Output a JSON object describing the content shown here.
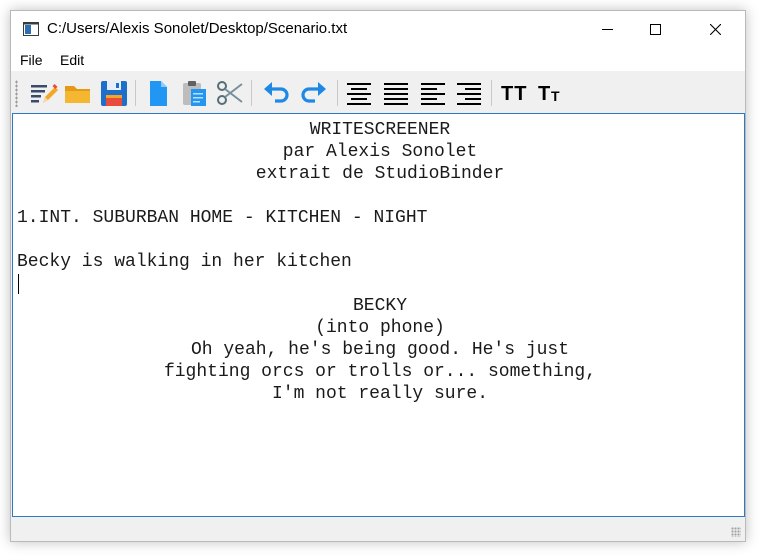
{
  "window": {
    "title": "C:/Users/Alexis Sonolet/Desktop/Scenario.txt",
    "controls": {
      "minimize_icon": "minimize-icon",
      "maximize_icon": "maximize-icon",
      "close_icon": "close-icon"
    }
  },
  "menubar": {
    "items": [
      "File",
      "Edit"
    ]
  },
  "toolbar": {
    "tools": [
      "new-document-icon",
      "open-folder-icon",
      "save-icon",
      "copy-icon",
      "paste-icon",
      "cut-icon",
      "undo-icon",
      "redo-icon",
      "align-center-icon",
      "align-justify-icon",
      "align-left-icon",
      "align-right-icon",
      "uppercase-icon",
      "small-caps-icon"
    ],
    "uppercase_label": "TT",
    "smallcaps_big": "T",
    "smallcaps_small": "T"
  },
  "colors": {
    "accent": "#2b79c7",
    "folder": "#f0a81e",
    "save": "#1e6fc9",
    "undo": "#1e88e5"
  },
  "document": {
    "lines": [
      {
        "text": "WRITESCREENER",
        "align": "center"
      },
      {
        "text": "par Alexis Sonolet",
        "align": "center"
      },
      {
        "text": "extrait de StudioBinder",
        "align": "center"
      },
      {
        "text": "",
        "align": "left"
      },
      {
        "text": "1.INT. SUBURBAN HOME - KITCHEN - NIGHT",
        "align": "left"
      },
      {
        "text": "",
        "align": "left"
      },
      {
        "text": "Becky is walking in her kitchen",
        "align": "left"
      },
      {
        "text": "",
        "align": "left"
      },
      {
        "text": "BECKY",
        "align": "center"
      },
      {
        "text": "(into phone)",
        "align": "center"
      },
      {
        "text": "Oh yeah, he's being good. He's just",
        "align": "center"
      },
      {
        "text": "fighting orcs or trolls or... something,",
        "align": "center"
      },
      {
        "text": "I'm not really sure.",
        "align": "center"
      }
    ]
  }
}
